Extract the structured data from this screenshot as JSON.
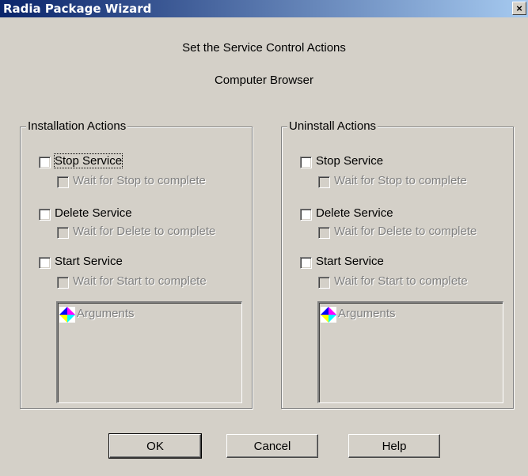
{
  "window": {
    "title": "Radia Package Wizard",
    "close_label": "×"
  },
  "heading": "Set the Service Control Actions",
  "service_name": "Computer Browser",
  "install": {
    "legend": "Installation Actions",
    "stop_label": "Stop Service",
    "stop_wait_label": "Wait for Stop to complete",
    "delete_label": "Delete Service",
    "delete_wait_label": "Wait for Delete to complete",
    "start_label": "Start Service",
    "start_wait_label": "Wait for Start to complete",
    "arguments_label": "Arguments"
  },
  "uninstall": {
    "legend": "Uninstall Actions",
    "stop_label": "Stop Service",
    "stop_wait_label": "Wait for Stop to complete",
    "delete_label": "Delete Service",
    "delete_wait_label": "Wait for Delete to complete",
    "start_label": "Start Service",
    "start_wait_label": "Wait for Start to complete",
    "arguments_label": "Arguments"
  },
  "buttons": {
    "ok": "OK",
    "cancel": "Cancel",
    "help": "Help"
  }
}
